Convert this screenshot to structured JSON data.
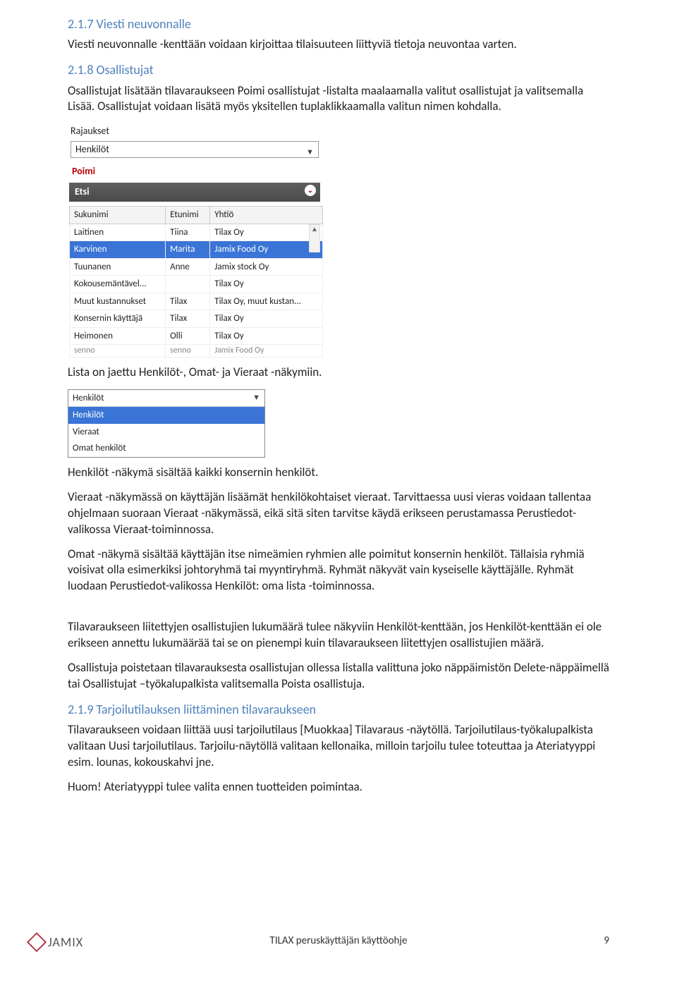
{
  "sections": {
    "s217_title": "2.1.7 Viesti neuvonnalle",
    "s217_text": "Viesti neuvonnalle -kenttään voidaan kirjoittaa tilaisuuteen liittyviä tietoja neuvontaa varten.",
    "s218_title": "2.1.8 Osallistujat",
    "s218_text": "Osallistujat lisätään tilavaraukseen Poimi osallistujat -listalta maalaamalla valitut osallistujat ja valitsemalla Lisää. Osallistujat voidaan lisätä myös yksitellen tuplaklikkaamalla valitun nimen kohdalla.",
    "s219_title": "2.1.9 Tarjoilutilauksen liittäminen tilavaraukseen"
  },
  "panel1": {
    "rajaukset": "Rajaukset",
    "dropdown": "Henkilöt",
    "poimi": "Poimi",
    "etsi": "Etsi",
    "headers": {
      "sukunimi": "Sukunimi",
      "etunimi": "Etunimi",
      "yhtio": "Yhtiö"
    },
    "rows": [
      {
        "sukunimi": "Laitinen",
        "etunimi": "Tiina",
        "yhtio": "Tilax Oy",
        "selected": false
      },
      {
        "sukunimi": "Karvinen",
        "etunimi": "Marita",
        "yhtio": "Jamix Food Oy",
        "selected": true
      },
      {
        "sukunimi": "Tuunanen",
        "etunimi": "Anne",
        "yhtio": "Jamix stock Oy",
        "selected": false
      },
      {
        "sukunimi": "Kokousemäntävel...",
        "etunimi": "",
        "yhtio": "Tilax Oy",
        "selected": false
      },
      {
        "sukunimi": "Muut kustannukset",
        "etunimi": "Tilax",
        "yhtio": "Tilax Oy, muut kustan...",
        "selected": false
      },
      {
        "sukunimi": "Konsernin käyttäjä",
        "etunimi": "Tilax",
        "yhtio": "Tilax Oy",
        "selected": false
      },
      {
        "sukunimi": "Heimonen",
        "etunimi": "Olli",
        "yhtio": "Tilax Oy",
        "selected": false
      },
      {
        "sukunimi": "senno",
        "etunimi": "senno",
        "yhtio": "Jamix Food Oy",
        "selected": false,
        "last": true
      }
    ]
  },
  "between1": "Lista on jaettu Henkilöt-, Omat- ja Vieraat -näkymiin.",
  "panel2": {
    "head": "Henkilöt",
    "items": [
      {
        "label": "Henkilöt",
        "selected": true
      },
      {
        "label": "Vieraat",
        "selected": false
      },
      {
        "label": "Omat henkilöt",
        "selected": false
      }
    ]
  },
  "body": {
    "p1": "Henkilöt -näkymä sisältää kaikki konsernin henkilöt.",
    "p2": "Vieraat -näkymässä on käyttäjän lisäämät henkilökohtaiset vieraat. Tarvittaessa uusi vieras voidaan tallentaa ohjelmaan suoraan Vieraat -näkymässä, eikä sitä siten tarvitse käydä erikseen perustamassa Perustiedot-valikossa Vieraat-toiminnossa.",
    "p3": "Omat -näkymä sisältää käyttäjän itse nimeämien ryhmien alle poimitut konsernin henkilöt. Tällaisia ryhmiä voisivat olla esimerkiksi johtoryhmä tai myyntiryhmä. Ryhmät näkyvät vain kyseiselle käyttäjälle. Ryhmät luodaan Perustiedot-valikossa Henkilöt: oma lista -toiminnossa.",
    "p4": "Tilavaraukseen liitettyjen osallistujien lukumäärä tulee näkyviin Henkilöt-kenttään, jos Henkilöt-kenttään ei ole erikseen annettu lukumäärää tai se on pienempi kuin tilavaraukseen liitettyjen osallistujien määrä.",
    "p5": "Osallistuja poistetaan tilavarauksesta osallistujan ollessa listalla valittuna joko näppäimistön Delete-näppäimellä tai Osallistujat –työkalupalkista valitsemalla Poista osallistuja.",
    "p6": "Tilavaraukseen voidaan liittää uusi tarjoilutilaus [Muokkaa] Tilavaraus -näytöllä. Tarjoilutilaus-työkalupalkista valitaan Uusi tarjoilutilaus. Tarjoilu-näytöllä valitaan kellonaika, milloin tarjoilu tulee toteuttaa ja Ateriatyyppi esim. lounas, kokouskahvi jne.",
    "p7": "Huom! Ateriatyyppi tulee valita ennen tuotteiden poimintaa."
  },
  "footer": {
    "logo_text": "JAMIX",
    "center": "TILAX peruskäyttäjän käyttöohje",
    "page": "9"
  }
}
